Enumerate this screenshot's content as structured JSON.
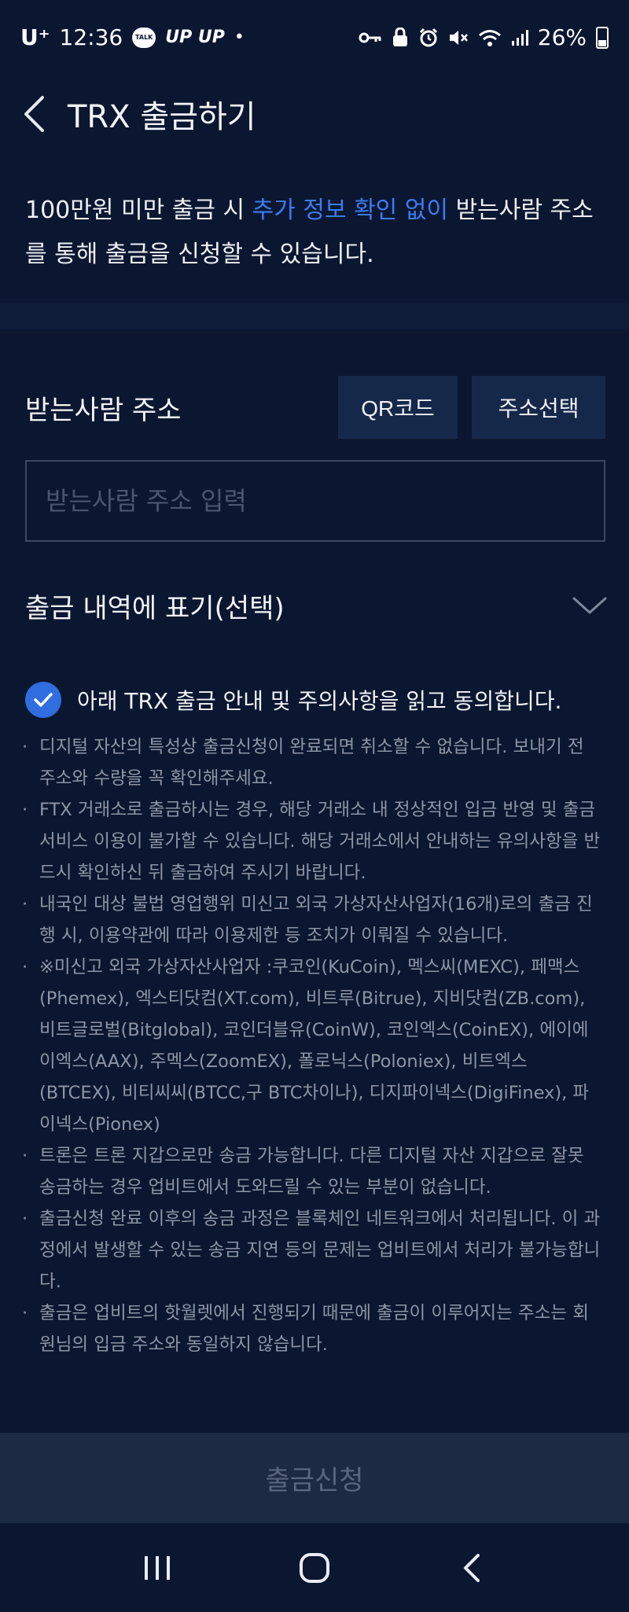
{
  "status_bar": {
    "carrier": "U⁺",
    "time": "12:36",
    "talk_badge": "TALK",
    "upup": "UP UP",
    "dot": "•",
    "battery": "26%"
  },
  "header": {
    "title": "TRX 출금하기"
  },
  "notice": {
    "part1": "100만원 미만 출금 시 ",
    "highlight": "추가 정보 확인 없이",
    "part2": " 받는사람 주소를 통해 출금을 신청할 수 있습니다."
  },
  "recipient": {
    "label": "받는사람 주소",
    "qr_button": "QR코드",
    "address_select_button": "주소선택",
    "input_placeholder": "받는사람 주소 입력"
  },
  "memo": {
    "label": "출금 내역에 표기(선택)"
  },
  "agreement": {
    "checked": true,
    "text": "아래 TRX 출금 안내 및 주의사항을 읽고 동의합니다."
  },
  "cautions": [
    "디지털 자산의 특성상 출금신청이 완료되면 취소할 수 없습니다. 보내기 전 주소와 수량을 꼭 확인해주세요.",
    "FTX 거래소로 출금하시는 경우, 해당 거래소 내 정상적인 입금 반영 및 출금 서비스 이용이 불가할 수 있습니다. 해당 거래소에서 안내하는 유의사항을 반드시 확인하신 뒤 출금하여 주시기 바랍니다.",
    "내국인 대상 불법 영업행위 미신고 외국 가상자산사업자(16개)로의 출금 진행 시, 이용약관에 따라 이용제한 등 조치가 이뤄질 수 있습니다.",
    "※미신고 외국 가상자산사업자 :쿠코인(KuCoin), 멕스씨(MEXC), 페맥스(Phemex), 엑스티닷컴(XT.com), 비트루(Bitrue), 지비닷컴(ZB.com), 비트글로벌(Bitglobal), 코인더블유(CoinW), 코인엑스(CoinEX), 에이에이엑스(AAX), 주멕스(ZoomEX), 폴로닉스(Poloniex), 비트엑스(BTCEX), 비티씨씨(BTCC,구 BTC차이나), 디지파이넥스(DigiFinex), 파이넥스(Pionex)",
    "트론은 트론 지갑으로만 송금 가능합니다. 다른 디지털 자산 지갑으로 잘못 송금하는 경우 업비트에서 도와드릴 수 있는 부분이 없습니다.",
    "출금신청 완료 이후의 송금 과정은 블록체인 네트워크에서 처리됩니다. 이 과정에서 발생할 수 있는 송금 지연 등의 문제는 업비트에서 처리가 불가능합니다.",
    "출금은 업비트의 핫월렛에서 진행되기 때문에 출금이 이루어지는 주소는 회원님의 입금 주소와 동일하지 않습니다."
  ],
  "submit": {
    "label": "출금신청"
  },
  "icons": {
    "back": "chevron-left-icon",
    "expand": "chevron-down-icon",
    "check": "check-icon",
    "nav_recent": "recent-apps-icon",
    "nav_home": "home-icon",
    "nav_back": "nav-back-icon"
  },
  "colors": {
    "background": "#0b1731",
    "accent": "#2f6de0",
    "highlight": "#3d7bf2",
    "button_dark": "#16284a",
    "submit_disabled": "#1d2a44"
  }
}
